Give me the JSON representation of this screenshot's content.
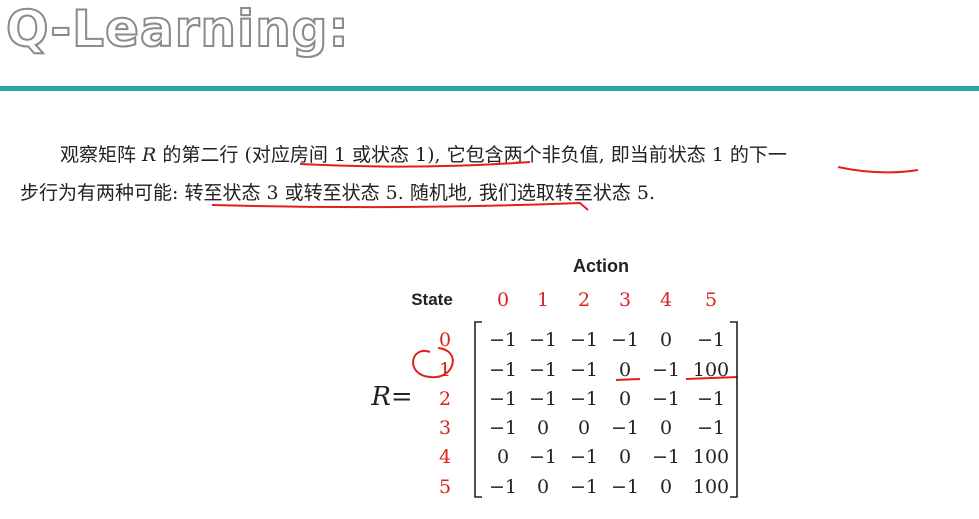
{
  "slide": {
    "title": "Q-Learning:"
  },
  "paragraph": {
    "line1_a": "观察矩阵 ",
    "line1_var": "R",
    "line1_b": " 的第二行 (对应房间 1 或状态 1), 它包含两个非负值, 即当前状态 1 的下一",
    "line2": "步行为有两种可能: 转至状态 3 或转至状态 5. 随机地, 我们选取转至状态 5."
  },
  "matrix": {
    "action_header": "Action",
    "state_header": "State",
    "label": "R=",
    "columns": [
      "0",
      "1",
      "2",
      "3",
      "4",
      "5"
    ],
    "rows": [
      {
        "state": "0",
        "values": [
          "−1",
          "−1",
          "−1",
          "−1",
          "0",
          "−1"
        ]
      },
      {
        "state": "1",
        "values": [
          "−1",
          "−1",
          "−1",
          "0",
          "−1",
          "100"
        ]
      },
      {
        "state": "2",
        "values": [
          "−1",
          "−1",
          "−1",
          "0",
          "−1",
          "−1"
        ]
      },
      {
        "state": "3",
        "values": [
          "−1",
          "0",
          "0",
          "−1",
          "0",
          "−1"
        ]
      },
      {
        "state": "4",
        "values": [
          "0",
          "−1",
          "−1",
          "0",
          "−1",
          "100"
        ]
      },
      {
        "state": "5",
        "values": [
          "−1",
          "0",
          "−1",
          "−1",
          "0",
          "100"
        ]
      }
    ],
    "label_color": "#e0201b"
  }
}
